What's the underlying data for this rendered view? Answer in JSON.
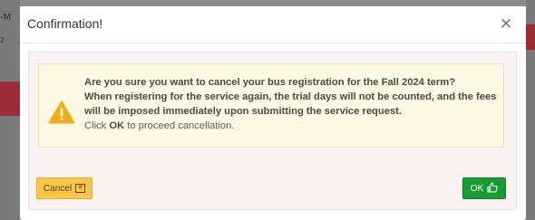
{
  "background": {
    "fragment_left_top": "-M",
    "fragment_left_mid": "2",
    "brand_red": "#9b2d37"
  },
  "modal": {
    "title": "Confirmation!",
    "close_glyph": "×"
  },
  "alert": {
    "icon": "warning-triangle-icon",
    "icon_color": "#f0ad1c",
    "line1": "Are you sure you want to cancel your bus registration for the Fall 2024 term?",
    "line2": "When registering for the service again, the trial days will not be counted, and the fees",
    "line3": "will be imposed immediately upon submitting the service request.",
    "line4_prefix": "Click ",
    "line4_bold": "OK",
    "line4_suffix": " to proceed cancellation."
  },
  "buttons": {
    "cancel_label": "Cancel",
    "cancel_icon": "close-box-icon",
    "cancel_icon_glyph": "✕",
    "cancel_color": "#f7c64a",
    "ok_label": "OK",
    "ok_icon": "thumbs-up-icon",
    "ok_color": "#1a9b2f"
  }
}
